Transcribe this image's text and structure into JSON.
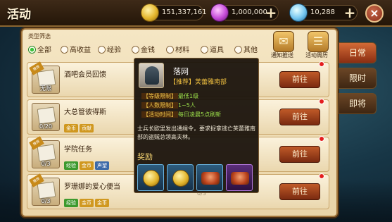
{
  "header": {
    "title": "活动",
    "currencies": [
      {
        "icon": "gold-coin-icon",
        "value": "151,337,161"
      },
      {
        "icon": "purple-gem-icon",
        "value": "1,000,000"
      },
      {
        "icon": "diamond-icon",
        "value": "10,288"
      }
    ],
    "close_label": "×"
  },
  "filters": {
    "title": "类型筛选",
    "options": [
      "全部",
      "高收益",
      "经验",
      "金钱",
      "材料",
      "道具",
      "其他"
    ],
    "selected": "全部"
  },
  "header_buttons": [
    {
      "icon": "notification-icon",
      "label": "通知推送"
    },
    {
      "icon": "calendar-scroll-icon",
      "label": "活动周历"
    }
  ],
  "side_tabs": [
    {
      "label": "日常",
      "active": true
    },
    {
      "label": "限时",
      "active": false
    },
    {
      "label": "即将",
      "active": false
    }
  ],
  "activities": [
    {
      "name": "酒吧会员回馈",
      "count": "无限",
      "tags": [],
      "button": "前往",
      "badge": "推荐"
    },
    {
      "name": "大总管彼得斯",
      "count": "0/20",
      "tags": [
        {
          "text": "金币",
          "color": "gold"
        },
        {
          "text": "贡献",
          "color": "gold"
        }
      ],
      "button": "前往"
    },
    {
      "name": "学院任务",
      "count": "0/3",
      "tags": [
        {
          "text": "经验",
          "color": "green"
        },
        {
          "text": "金币",
          "color": "gold"
        },
        {
          "text": "声望",
          "color": "blue"
        }
      ],
      "button": "前往",
      "badge": "推荐"
    },
    {
      "name": "罗珊娜的爱心便当",
      "count": "0/3",
      "tags": [
        {
          "text": "经验",
          "color": "green"
        },
        {
          "text": "金币",
          "color": "gold"
        },
        {
          "text": "金币",
          "color": "gold"
        }
      ],
      "button": "前往",
      "badge": "推荐"
    }
  ],
  "obscured_row": {
    "count": "0/3"
  },
  "popup": {
    "title": "落网",
    "recommended": "【推荐】芙蕾雅南部",
    "info": [
      {
        "label": "【等级限制】",
        "value": "最低1级"
      },
      {
        "label": "【人数限制】",
        "value": "1~5人"
      },
      {
        "label": "【活动时间】",
        "value": "每日凌晨5点刷新"
      }
    ],
    "description": "士兵长欧里发出通缉令，要求捉拿逃亡芙蕾雅南部的盗贼总领高夫林。",
    "reward_title": "奖励",
    "rewards": [
      {
        "icon": "gold-coin-icon",
        "rarity": "blue"
      },
      {
        "icon": "gold-coin-icon",
        "rarity": "blue"
      },
      {
        "icon": "food-icon",
        "rarity": "blue"
      },
      {
        "icon": "meat-icon",
        "rarity": "purple"
      }
    ]
  }
}
